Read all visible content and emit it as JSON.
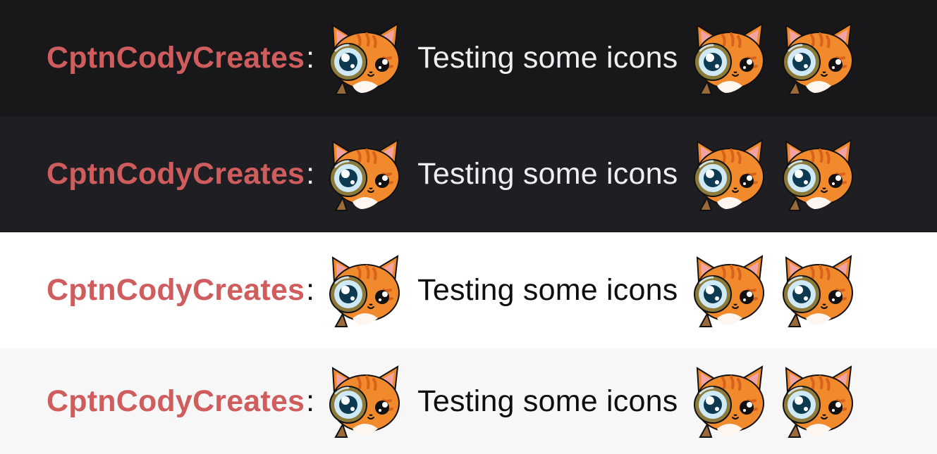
{
  "rows": [
    {
      "theme": "dark-1",
      "username": "CptnCodyCreates",
      "colon": ":",
      "message": "Testing some icons",
      "emote_icon": "cat-magnifier-emote-icon"
    },
    {
      "theme": "dark-2",
      "username": "CptnCodyCreates",
      "colon": ":",
      "message": "Testing some icons",
      "emote_icon": "cat-magnifier-emote-icon"
    },
    {
      "theme": "light-1",
      "username": "CptnCodyCreates",
      "colon": ":",
      "message": "Testing some icons",
      "emote_icon": "cat-magnifier-emote-icon"
    },
    {
      "theme": "light-2",
      "username": "CptnCodyCreates",
      "colon": ":",
      "message": "Testing some icons",
      "emote_icon": "cat-magnifier-emote-icon"
    }
  ],
  "colors": {
    "username": "#d05d5d",
    "dark_bg_1": "#18181b",
    "dark_bg_2": "#1f1f23",
    "light_bg_1": "#ffffff",
    "light_bg_2": "#f7f7f8",
    "cat_orange": "#f08a2c",
    "cat_stripes": "#d9611b",
    "magnifier_rim": "#8b7a3a"
  }
}
